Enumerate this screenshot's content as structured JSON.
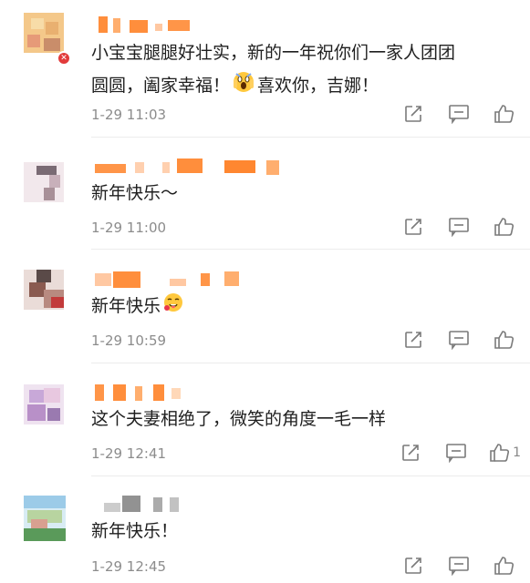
{
  "comments": [
    {
      "text_line1": "小宝宝腿腿好壮实，新的一年祝你们一家人团团",
      "text_line2_a": "圆圆，阖家幸福！",
      "text_line2_b": "喜欢你，吉娜！",
      "time": "1-29 11:03"
    },
    {
      "text_line1": "新年快乐～",
      "time": "1-29 11:00"
    },
    {
      "text_line1": "新年快乐",
      "time": "1-29 10:59"
    },
    {
      "text_line1": "这个夫妻相绝了，微笑的角度一毛一样",
      "time": "1-29 12:41",
      "likes": "1"
    },
    {
      "text_line1": "新年快乐！",
      "time": "1-29 12:45"
    }
  ],
  "colors": {
    "name_orange": "#ff7a1a",
    "meta_gray": "#8c8c8c",
    "icon_gray": "#7a7a7a"
  },
  "icons": [
    "share-icon",
    "comment-icon",
    "like-icon"
  ]
}
